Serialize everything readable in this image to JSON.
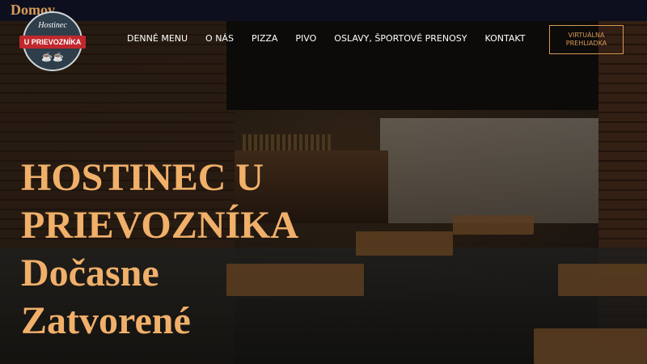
{
  "topbar": {
    "text": "Domov"
  },
  "logo": {
    "top_text": "Hostinec",
    "ribbon_text": "U PRIEVOZNÍKA",
    "mugs": "☕☕"
  },
  "nav": {
    "items": [
      {
        "label": "DENNÉ MENU"
      },
      {
        "label": "O NÁS"
      },
      {
        "label": "PIZZA"
      },
      {
        "label": "PIVO"
      },
      {
        "label": "OSLAVY, ŠPORTOVÉ PRENOSY"
      },
      {
        "label": "KONTAKT"
      }
    ]
  },
  "cta": {
    "line1": "VIRTUÁLNA",
    "line2": "PREHLIADKA"
  },
  "headline": {
    "line1": "HOSTINEC U",
    "line2": "PRIEVOZNÍKA",
    "line3": "Dočasne",
    "line4": "Zatvorené"
  },
  "colors": {
    "accent": "#d79a56",
    "headline": "#f0b06a",
    "topbar": "#0d0f1f",
    "logo_ribbon": "#c0282d"
  }
}
